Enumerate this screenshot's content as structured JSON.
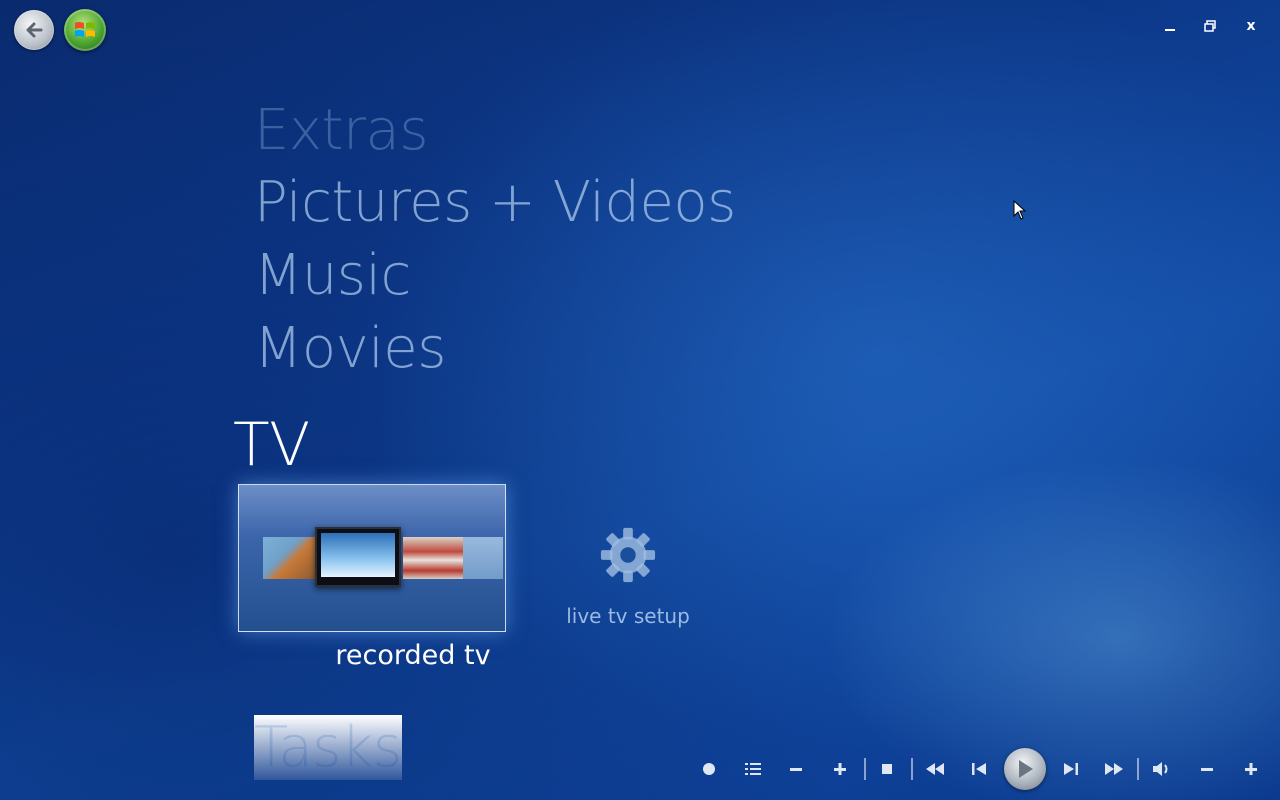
{
  "window": {
    "controls": {
      "minimize": "minimize",
      "restore": "restore",
      "close": "x"
    }
  },
  "menu": {
    "items": [
      {
        "label": "Extras"
      },
      {
        "label": "Pictures + Videos"
      },
      {
        "label": "Music"
      },
      {
        "label": "Movies"
      },
      {
        "label": "TV",
        "selected": true
      },
      {
        "label": "Tasks"
      }
    ]
  },
  "tv": {
    "tiles": [
      {
        "label": "recorded tv",
        "selected": true
      },
      {
        "label": "live tv setup",
        "icon": "gear-icon"
      }
    ]
  },
  "transport": {
    "buttons": [
      "record-icon",
      "guide-icon",
      "channel-down-icon",
      "channel-up-icon",
      "stop-icon",
      "rewind-icon",
      "previous-icon",
      "play-icon",
      "next-icon",
      "fast-forward-icon",
      "volume-icon",
      "volume-down-icon",
      "volume-up-icon"
    ]
  },
  "colors": {
    "background": "#0d3a8c",
    "menu_text": "#aac8eb",
    "selected_text": "#ffffff"
  }
}
